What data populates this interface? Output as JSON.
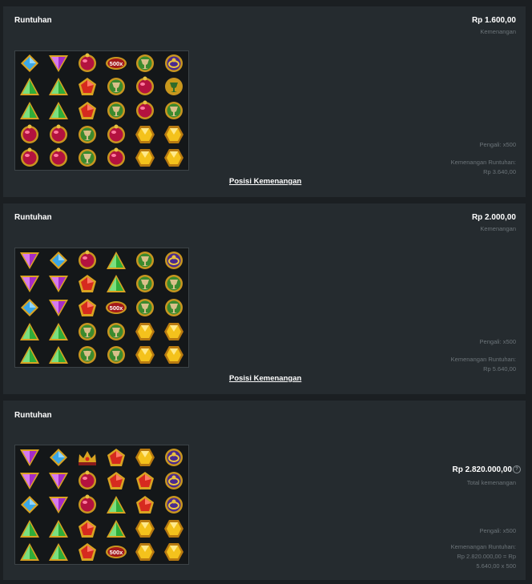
{
  "panels": [
    {
      "title": "Runtuhan",
      "amount": "Rp 1.600,00",
      "amount_label": "Kemenangan",
      "multiplier": "Pengali: x500",
      "cascade_label": "Kemenangan Runtuhan:",
      "cascade_value": "Rp 3.640,00",
      "link": "Posisi Kemenangan",
      "grid": [
        [
          "blue-diamond",
          "purple-triangle",
          "red-amulet",
          "multiplier",
          "green-goblet",
          "purple-ring"
        ],
        [
          "green-triangle",
          "green-triangle",
          "red-pentagon",
          "green-goblet",
          "red-amulet",
          "gold-goblet"
        ],
        [
          "green-triangle",
          "green-triangle",
          "red-pentagon",
          "green-goblet",
          "red-amulet",
          "green-goblet"
        ],
        [
          "red-amulet",
          "red-amulet",
          "green-goblet",
          "red-amulet",
          "gold-hexagon",
          "gold-hexagon"
        ],
        [
          "red-amulet",
          "red-amulet",
          "green-goblet",
          "red-amulet",
          "gold-hexagon",
          "gold-hexagon"
        ]
      ],
      "multiplier_badge": "500x"
    },
    {
      "title": "Runtuhan",
      "amount": "Rp 2.000,00",
      "amount_label": "Kemenangan",
      "multiplier": "Pengali: x500",
      "cascade_label": "Kemenangan Runtuhan:",
      "cascade_value": "Rp 5.640,00",
      "link": "Posisi Kemenangan",
      "grid": [
        [
          "purple-triangle",
          "blue-diamond",
          "red-amulet",
          "green-triangle",
          "green-goblet",
          "purple-ring"
        ],
        [
          "purple-triangle",
          "purple-triangle",
          "red-pentagon",
          "green-triangle",
          "green-goblet",
          "green-goblet"
        ],
        [
          "blue-diamond",
          "purple-triangle",
          "red-pentagon",
          "multiplier",
          "green-goblet",
          "green-goblet"
        ],
        [
          "green-triangle",
          "green-triangle",
          "green-goblet",
          "green-goblet",
          "gold-hexagon",
          "gold-hexagon"
        ],
        [
          "green-triangle",
          "green-triangle",
          "green-goblet",
          "green-goblet",
          "gold-hexagon",
          "gold-hexagon"
        ]
      ],
      "multiplier_badge": "500x"
    },
    {
      "title": "Runtuhan",
      "total_amount": "Rp 2.820.000,00",
      "help_icon": "?",
      "total_label": "Total kemenangan",
      "multiplier": "Pengali: x500",
      "cascade_label": "Kemenangan Runtuhan:",
      "cascade_value_1": "Rp 2.820.000,00 = Rp",
      "cascade_value_2": "5.640,00 x 500",
      "grid": [
        [
          "purple-triangle",
          "blue-diamond",
          "crown",
          "red-pentagon",
          "gold-hexagon",
          "purple-ring"
        ],
        [
          "purple-triangle",
          "purple-triangle",
          "red-amulet",
          "red-pentagon",
          "red-pentagon",
          "purple-ring"
        ],
        [
          "blue-diamond",
          "purple-triangle",
          "red-amulet",
          "green-triangle",
          "red-pentagon",
          "purple-ring"
        ],
        [
          "green-triangle",
          "green-triangle",
          "red-pentagon",
          "green-triangle",
          "gold-hexagon",
          "gold-hexagon"
        ],
        [
          "green-triangle",
          "green-triangle",
          "red-pentagon",
          "multiplier",
          "gold-hexagon",
          "gold-hexagon"
        ]
      ],
      "multiplier_badge": "500x"
    }
  ]
}
